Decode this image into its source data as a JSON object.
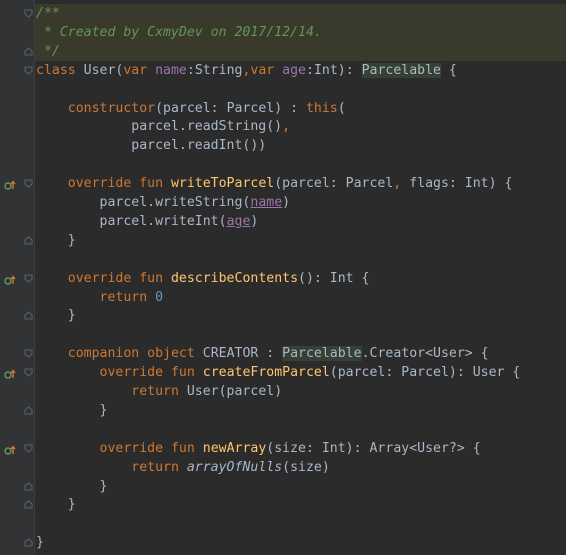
{
  "editor": {
    "language": "Kotlin",
    "lines": [
      {
        "tokens": [
          {
            "t": "/**",
            "c": "c-comment"
          }
        ]
      },
      {
        "tokens": [
          {
            "t": " * Created by CxmyDev on 2017/12/14.",
            "c": "c-comment"
          }
        ]
      },
      {
        "tokens": [
          {
            "t": " */",
            "c": "c-comment"
          }
        ]
      },
      {
        "tokens": [
          {
            "t": "class ",
            "c": "c-keyword"
          },
          {
            "t": "User(",
            "c": "c-plain"
          },
          {
            "t": "var ",
            "c": "c-keyword"
          },
          {
            "t": "name",
            "c": "c-prop2"
          },
          {
            "t": ":String",
            "c": "c-plain"
          },
          {
            "t": ",",
            "c": "c-keyword"
          },
          {
            "t": "var ",
            "c": "c-keyword"
          },
          {
            "t": "age",
            "c": "c-prop2"
          },
          {
            "t": ":Int): ",
            "c": "c-plain"
          },
          {
            "t": "Parcelable",
            "c": "c-highlight"
          },
          {
            "t": " {",
            "c": "c-plain"
          }
        ]
      },
      {
        "tokens": []
      },
      {
        "tokens": [
          {
            "t": "    ",
            "c": "c-plain"
          },
          {
            "t": "constructor",
            "c": "c-keyword"
          },
          {
            "t": "(parcel: Parcel) : ",
            "c": "c-plain"
          },
          {
            "t": "this",
            "c": "c-keyword"
          },
          {
            "t": "(",
            "c": "c-plain"
          }
        ]
      },
      {
        "tokens": [
          {
            "t": "            parcel.readString()",
            "c": "c-plain"
          },
          {
            "t": ",",
            "c": "c-keyword"
          }
        ]
      },
      {
        "tokens": [
          {
            "t": "            parcel.readInt())",
            "c": "c-plain"
          }
        ]
      },
      {
        "tokens": []
      },
      {
        "tokens": [
          {
            "t": "    ",
            "c": "c-plain"
          },
          {
            "t": "override fun ",
            "c": "c-keyword"
          },
          {
            "t": "writeToParcel",
            "c": "c-fn"
          },
          {
            "t": "(parcel: Parcel",
            "c": "c-plain"
          },
          {
            "t": ", ",
            "c": "c-keyword"
          },
          {
            "t": "flags: Int) {",
            "c": "c-plain"
          }
        ]
      },
      {
        "tokens": [
          {
            "t": "        parcel.writeString(",
            "c": "c-plain"
          },
          {
            "t": "name",
            "c": "c-prop"
          },
          {
            "t": ")",
            "c": "c-plain"
          }
        ]
      },
      {
        "tokens": [
          {
            "t": "        parcel.writeInt(",
            "c": "c-plain"
          },
          {
            "t": "age",
            "c": "c-prop"
          },
          {
            "t": ")",
            "c": "c-plain"
          }
        ]
      },
      {
        "tokens": [
          {
            "t": "    }",
            "c": "c-plain"
          }
        ]
      },
      {
        "tokens": []
      },
      {
        "tokens": [
          {
            "t": "    ",
            "c": "c-plain"
          },
          {
            "t": "override fun ",
            "c": "c-keyword"
          },
          {
            "t": "describeContents",
            "c": "c-fn"
          },
          {
            "t": "(): Int {",
            "c": "c-plain"
          }
        ]
      },
      {
        "tokens": [
          {
            "t": "        ",
            "c": "c-plain"
          },
          {
            "t": "return ",
            "c": "c-keyword"
          },
          {
            "t": "0",
            "c": "c-num"
          }
        ]
      },
      {
        "tokens": [
          {
            "t": "    }",
            "c": "c-plain"
          }
        ]
      },
      {
        "tokens": []
      },
      {
        "tokens": [
          {
            "t": "    ",
            "c": "c-plain"
          },
          {
            "t": "companion object ",
            "c": "c-keyword"
          },
          {
            "t": "CREATOR : ",
            "c": "c-plain"
          },
          {
            "t": "Parcelable",
            "c": "c-highlight"
          },
          {
            "t": ".Creator<User> {",
            "c": "c-plain"
          }
        ]
      },
      {
        "tokens": [
          {
            "t": "        ",
            "c": "c-plain"
          },
          {
            "t": "override fun ",
            "c": "c-keyword"
          },
          {
            "t": "createFromParcel",
            "c": "c-fn"
          },
          {
            "t": "(parcel: Parcel): User {",
            "c": "c-plain"
          }
        ]
      },
      {
        "tokens": [
          {
            "t": "            ",
            "c": "c-plain"
          },
          {
            "t": "return ",
            "c": "c-keyword"
          },
          {
            "t": "User(parcel)",
            "c": "c-plain"
          }
        ]
      },
      {
        "tokens": [
          {
            "t": "        }",
            "c": "c-plain"
          }
        ]
      },
      {
        "tokens": []
      },
      {
        "tokens": [
          {
            "t": "        ",
            "c": "c-plain"
          },
          {
            "t": "override fun ",
            "c": "c-keyword"
          },
          {
            "t": "newArray",
            "c": "c-fn"
          },
          {
            "t": "(size: Int): Array<User?> {",
            "c": "c-plain"
          }
        ]
      },
      {
        "tokens": [
          {
            "t": "            ",
            "c": "c-plain"
          },
          {
            "t": "return ",
            "c": "c-keyword"
          },
          {
            "t": "arrayOfNulls",
            "c": "c-ital"
          },
          {
            "t": "(size)",
            "c": "c-plain"
          }
        ]
      },
      {
        "tokens": [
          {
            "t": "        }",
            "c": "c-plain"
          }
        ]
      },
      {
        "tokens": [
          {
            "t": "    }",
            "c": "c-plain"
          }
        ]
      },
      {
        "tokens": []
      },
      {
        "tokens": [
          {
            "t": "}",
            "c": "c-plain"
          }
        ]
      }
    ],
    "gutter": {
      "implements_markers": [
        9,
        14,
        19,
        23
      ],
      "fold_markers": [
        {
          "line": 0,
          "kind": "open"
        },
        {
          "line": 2,
          "kind": "close"
        },
        {
          "line": 3,
          "kind": "open"
        },
        {
          "line": 9,
          "kind": "open"
        },
        {
          "line": 12,
          "kind": "close"
        },
        {
          "line": 14,
          "kind": "open"
        },
        {
          "line": 16,
          "kind": "close"
        },
        {
          "line": 18,
          "kind": "open"
        },
        {
          "line": 19,
          "kind": "open"
        },
        {
          "line": 21,
          "kind": "close"
        },
        {
          "line": 23,
          "kind": "open"
        },
        {
          "line": 25,
          "kind": "close"
        },
        {
          "line": 26,
          "kind": "close"
        },
        {
          "line": 28,
          "kind": "close"
        }
      ]
    },
    "colors": {
      "background": "#2b2b2b",
      "gutter": "#313335",
      "keyword": "#cc7832",
      "function": "#ffc66d",
      "comment": "#629755",
      "property": "#9876aa",
      "number": "#6897bb",
      "text": "#a9b7c6"
    }
  }
}
